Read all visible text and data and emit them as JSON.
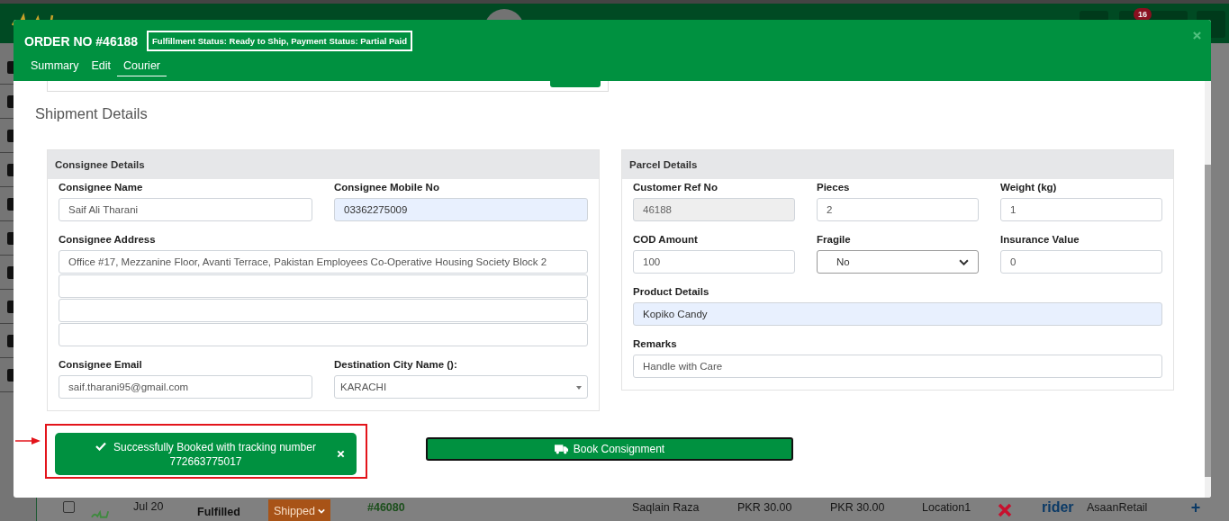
{
  "background_page": {
    "notification_count": "16",
    "order_row": {
      "checked": false,
      "date": "Jul 20",
      "fulfillment": "Fulfilled",
      "status": "Shipped",
      "order_no": "#46080",
      "customer": "Saqlain Raza",
      "amount_1": "PKR 30.00",
      "amount_2": "PKR 30.00",
      "location": "Location1",
      "courier_logo": "rider",
      "store": "AsaanRetail",
      "add": "+"
    }
  },
  "modal": {
    "title": "ORDER NO #46188",
    "status_badge": "Fulfillment Status: Ready to Ship,  Payment Status: Partial Paid",
    "tabs": [
      {
        "label": "Summary",
        "selected": false
      },
      {
        "label": "Edit",
        "selected": false
      },
      {
        "label": "Courier",
        "selected": true
      }
    ],
    "section_title": "Shipment Details",
    "consignee": {
      "title": "Consignee Details",
      "name": {
        "label": "Consignee Name",
        "kind": "input",
        "value": "Saif Ali Tharani"
      },
      "mobile": {
        "label": "Consignee Mobile No",
        "kind": "autofill",
        "value": "03362275009"
      },
      "address": {
        "label": "Consignee Address",
        "lines": [
          {
            "kind": "filled",
            "value": "Office #17, Mezzanine Floor, Avanti Terrace, Pakistan Employees Co-Operative Housing Society Block 2"
          },
          {
            "kind": "empty"
          },
          {
            "kind": "empty"
          },
          {
            "kind": "empty"
          }
        ]
      },
      "email": {
        "label": "Consignee Email",
        "kind": "input",
        "value": "saif.tharani95@gmail.com"
      },
      "city": {
        "label": "Destination City Name ():",
        "kind": "combo",
        "value": "KARACHI"
      }
    },
    "parcel": {
      "title": "Parcel Details",
      "fields": [
        {
          "label": "Customer Ref No",
          "kind": "readonly",
          "value": "46188"
        },
        {
          "label": "Pieces",
          "kind": "input",
          "value": "2"
        },
        {
          "label": "Weight (kg)",
          "kind": "input",
          "value": "1"
        },
        {
          "label": "COD Amount",
          "kind": "input",
          "value": "100"
        },
        {
          "label": "Fragile",
          "kind": "select",
          "value": "No"
        },
        {
          "label": "Insurance Value",
          "kind": "input",
          "value": "0"
        }
      ],
      "product": {
        "label": "Product Details",
        "kind": "autofill",
        "value": "Kopiko Candy"
      },
      "remarks": {
        "label": "Remarks",
        "kind": "input",
        "value": "Handle with Care"
      }
    },
    "alert": {
      "message": "Successfully Booked with tracking number 772663775017"
    },
    "book_button": "Book Consignment"
  }
}
